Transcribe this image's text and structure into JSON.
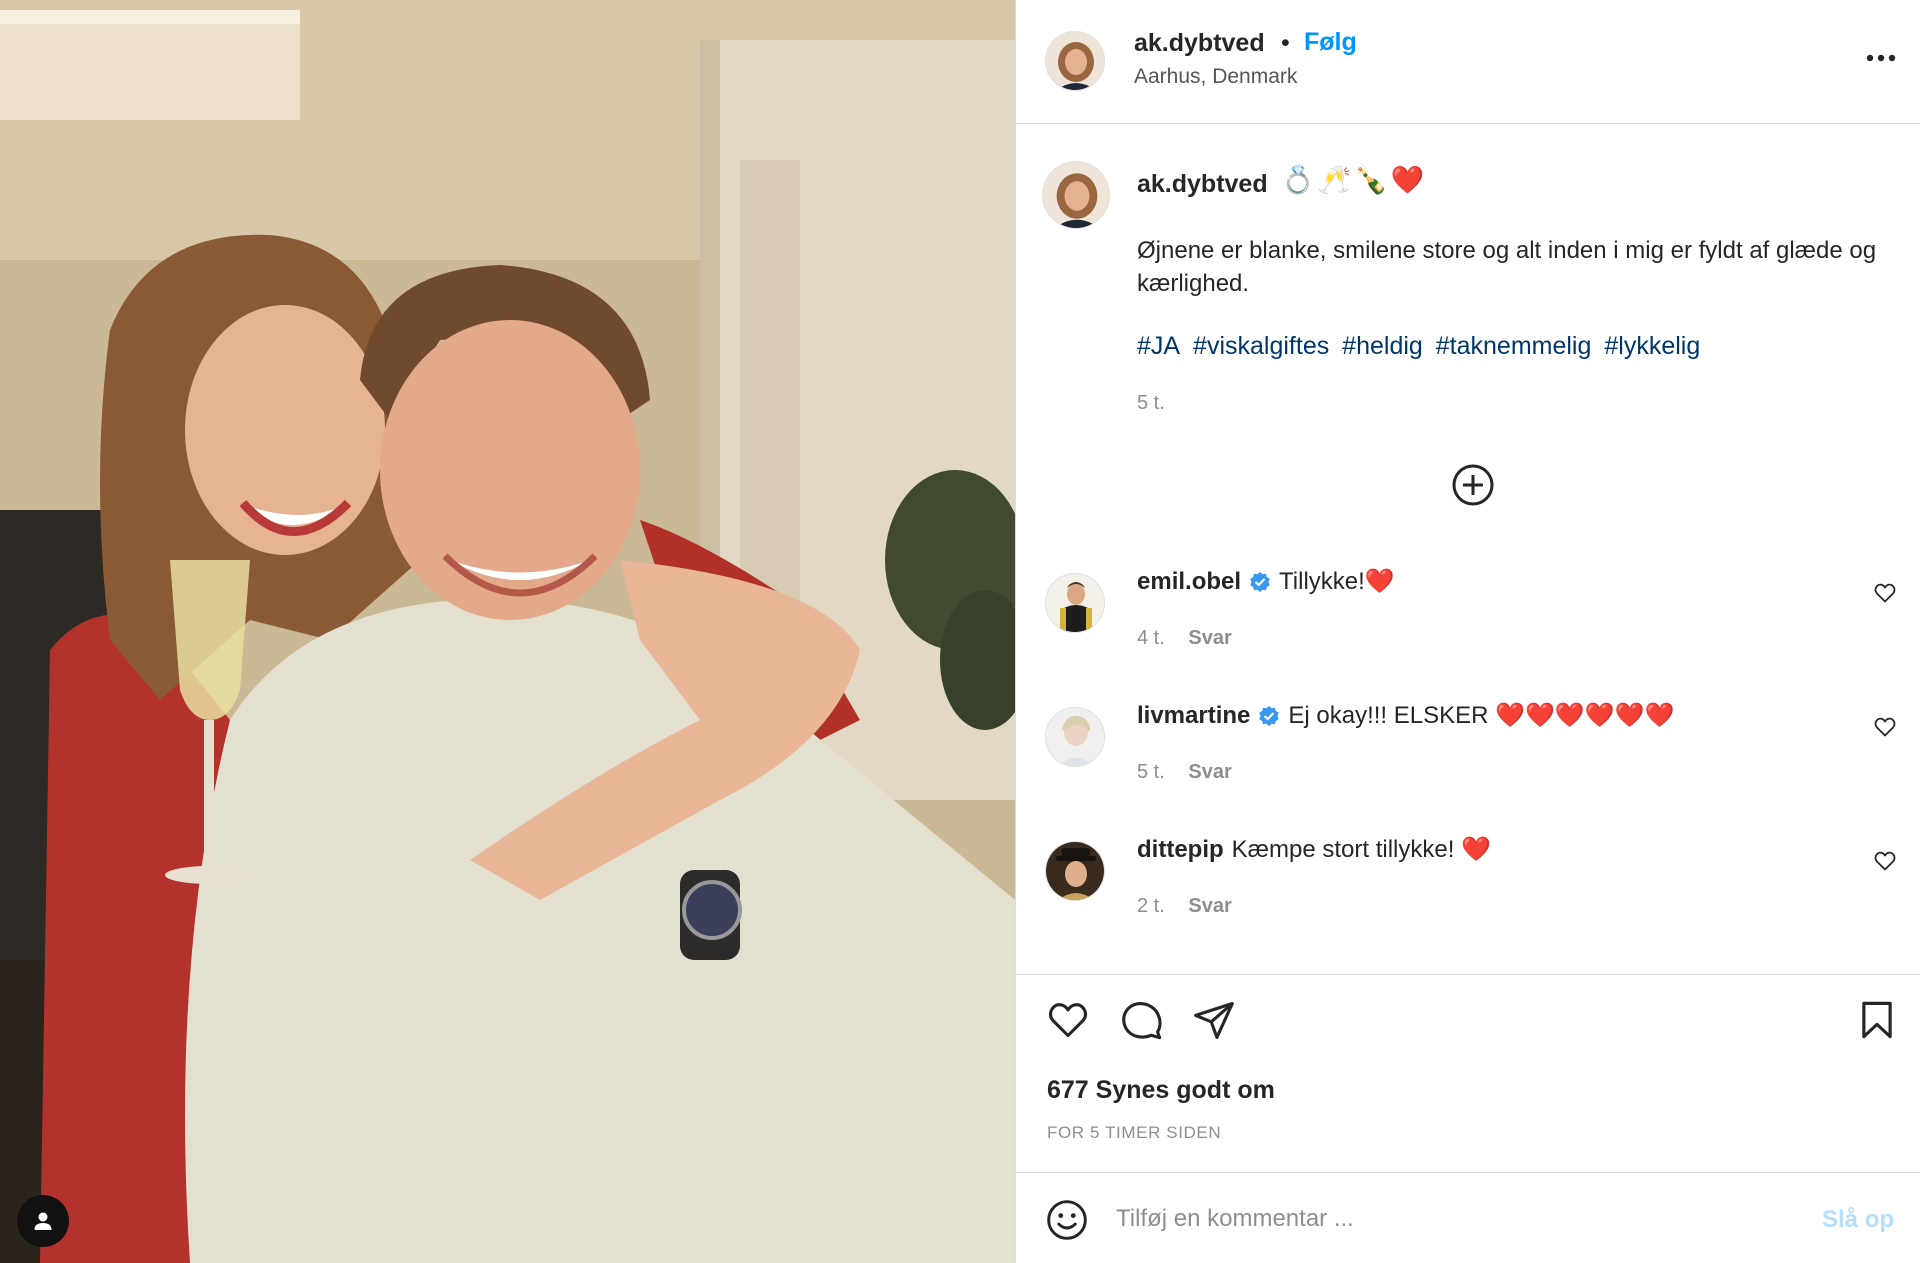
{
  "post": {
    "username": "ak.dybtved",
    "dot": "•",
    "follow_label": "Følg",
    "location": "Aarhus, Denmark",
    "more_icon": "more-horizontal-icon"
  },
  "caption": {
    "username": "ak.dybtved",
    "emojis": [
      "💍",
      "🥂",
      "🍾",
      "❤️"
    ],
    "text": "Øjnene er blanke, smilene store og alt inden i mig er fyldt af glæde og kærlighed.",
    "hashtags": [
      "#JA",
      "#viskalgiftes",
      "#heldig",
      "#taknemmelig",
      "#lykkelig"
    ],
    "time": "5 t."
  },
  "comments": [
    {
      "username": "emil.obel",
      "verified": true,
      "text": "Tillykke!❤️",
      "time": "4 t.",
      "reply_label": "Svar"
    },
    {
      "username": "livmartine",
      "verified": true,
      "text": "Ej okay!!! ELSKER ❤️❤️❤️❤️❤️❤️",
      "time": "5 t.",
      "reply_label": "Svar"
    },
    {
      "username": "dittepip",
      "verified": false,
      "text": "Kæmpe stort tillykke! ❤️",
      "time": "2 t.",
      "reply_label": "Svar"
    }
  ],
  "likes": "677 Synes godt om",
  "posted": "FOR 5 TIMER SIDEN",
  "comment_box": {
    "placeholder": "Tilføj en kommentar ...",
    "post_label": "Slå op"
  },
  "colors": {
    "link_blue": "#0095f6",
    "hashtag_blue": "#00376b",
    "verified_blue": "#3897f0",
    "post_disabled": "#b2dffc",
    "heart_red": "#ed4956"
  }
}
